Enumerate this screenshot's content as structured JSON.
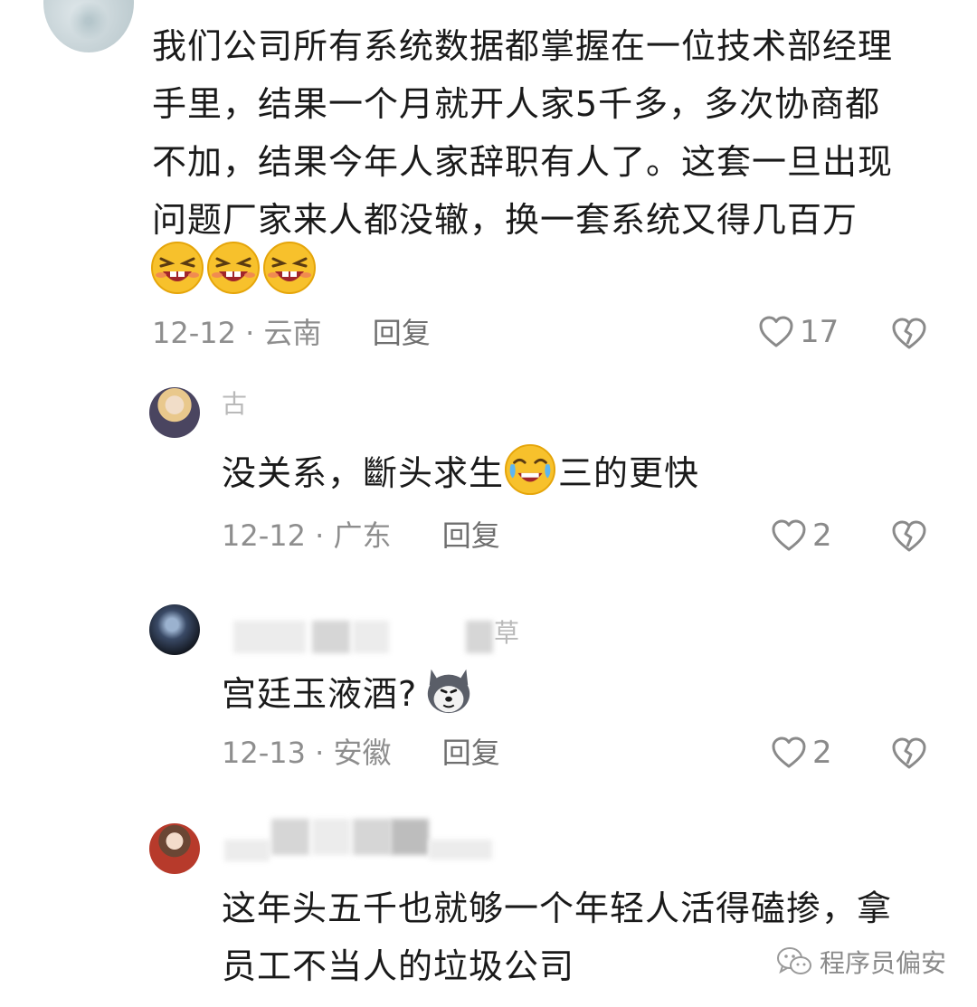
{
  "comments": [
    {
      "text_lines": [
        "我们公司所有系统数据都掌握在一位技术部经理",
        "手里，结果一个月就开人家5千多，多次协商都",
        "不加，结果今年人家辞职有人了。这套一旦出现",
        "问题厂家来人都没辙，换一套系统又得几百万"
      ],
      "emojis": [
        "laughing-emoji",
        "laughing-emoji",
        "laughing-emoji"
      ],
      "date": "12-12",
      "location": "云南",
      "reply_label": "回复",
      "likes": "17"
    },
    {
      "name_fragment": "古",
      "text_before_emoji": "没关系，斷头求生",
      "emoji": "crying-laughing-emoji",
      "text_after_emoji": "三的更快",
      "date": "12-12",
      "location": "广东",
      "reply_label": "回复",
      "likes": "2"
    },
    {
      "name_fragment": "草",
      "text": "宫廷玉液酒?",
      "emoji": "husky-dog-emoji",
      "date": "12-13",
      "location": "安徽",
      "reply_label": "回复",
      "likes": "2"
    },
    {
      "text_lines": [
        "这年头五千也就够一个年轻人活得磕掺，拿",
        "员工不当人的垃圾公司"
      ]
    }
  ],
  "separator": "·",
  "watermark": "程序员偏安",
  "icons": {
    "like": "heart-outline-icon",
    "dislike": "broken-heart-icon",
    "watermark": "wechat-icon"
  }
}
